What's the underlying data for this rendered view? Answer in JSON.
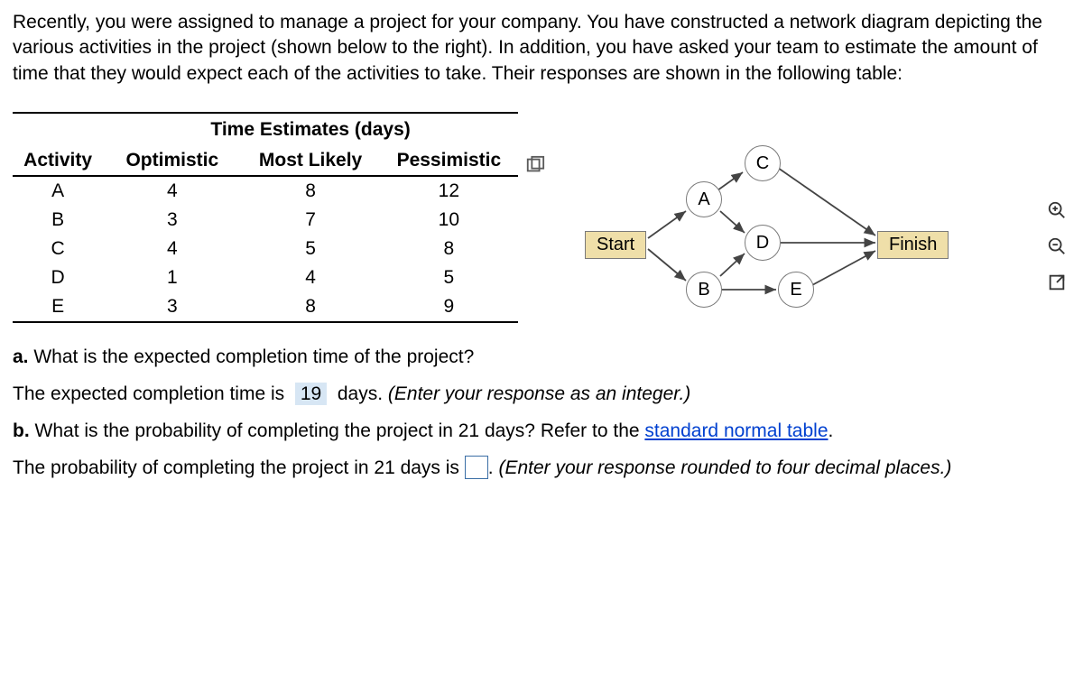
{
  "intro": "Recently, you were assigned to manage a project for your company. You have constructed a network diagram depicting the various activities in the project (shown below to the right). In addition, you have asked your team to estimate the amount of time that they would expect each of the activities to take. Their responses are shown in the following table:",
  "table": {
    "group_header": "Time Estimates (days)",
    "columns": {
      "activity": "Activity",
      "opt": "Optimistic",
      "ml": "Most Likely",
      "pes": "Pessimistic"
    },
    "rows": [
      {
        "activity": "A",
        "opt": "4",
        "ml": "8",
        "pes": "12"
      },
      {
        "activity": "B",
        "opt": "3",
        "ml": "7",
        "pes": "10"
      },
      {
        "activity": "C",
        "opt": "4",
        "ml": "5",
        "pes": "8"
      },
      {
        "activity": "D",
        "opt": "1",
        "ml": "4",
        "pes": "5"
      },
      {
        "activity": "E",
        "opt": "3",
        "ml": "8",
        "pes": "9"
      }
    ]
  },
  "diagram": {
    "start": "Start",
    "finish": "Finish",
    "nodes": {
      "A": "A",
      "B": "B",
      "C": "C",
      "D": "D",
      "E": "E"
    }
  },
  "qA": {
    "label": "a.",
    "text": "What is the expected completion time of the project?",
    "answer_prefix": "The expected completion time is",
    "answer_value": "19",
    "answer_suffix": "days.",
    "hint": "(Enter your response as an integer.)"
  },
  "qB": {
    "label": "b.",
    "text_before_link": "What is the probability of completing the project in 21 days? Refer to the ",
    "link_text": "standard normal table",
    "text_after_link": ".",
    "answer_prefix": "The probability of completing the project in 21 days is",
    "answer_suffix": ".",
    "hint": "(Enter your response rounded to four decimal places.)"
  },
  "chart_data": {
    "type": "table",
    "title": "Time Estimates (days)",
    "columns": [
      "Activity",
      "Optimistic",
      "Most Likely",
      "Pessimistic"
    ],
    "rows": [
      [
        "A",
        4,
        8,
        12
      ],
      [
        "B",
        3,
        7,
        10
      ],
      [
        "C",
        4,
        5,
        8
      ],
      [
        "D",
        1,
        4,
        5
      ],
      [
        "E",
        3,
        8,
        9
      ]
    ],
    "network": {
      "nodes": [
        "Start",
        "A",
        "B",
        "C",
        "D",
        "E",
        "Finish"
      ],
      "edges": [
        [
          "Start",
          "A"
        ],
        [
          "Start",
          "B"
        ],
        [
          "A",
          "C"
        ],
        [
          "A",
          "D"
        ],
        [
          "B",
          "D"
        ],
        [
          "B",
          "E"
        ],
        [
          "C",
          "Finish"
        ],
        [
          "D",
          "Finish"
        ],
        [
          "E",
          "Finish"
        ]
      ]
    }
  }
}
